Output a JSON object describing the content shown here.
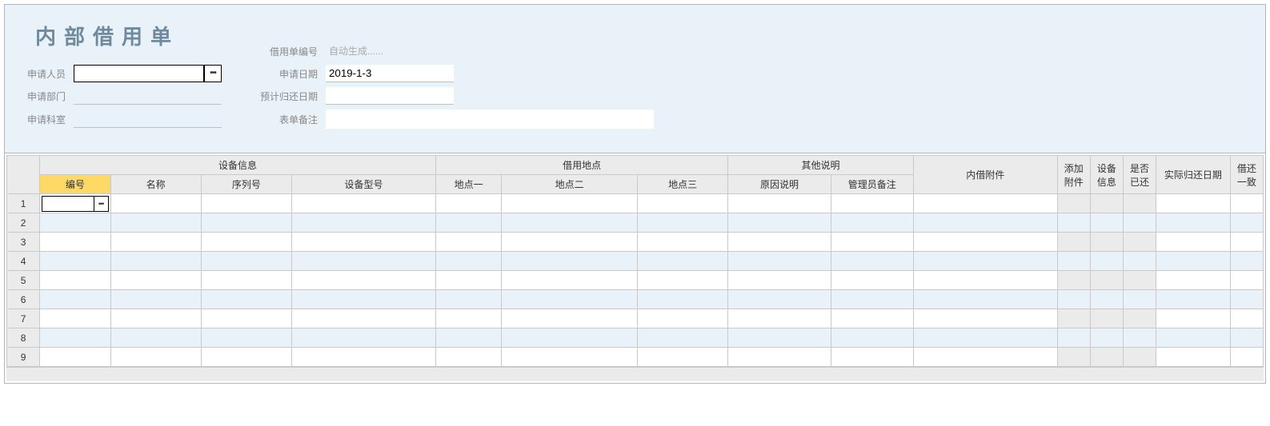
{
  "header": {
    "title": "内部借用单",
    "fields": {
      "applicant_label": "申请人员",
      "applicant_value": "",
      "dept_label": "申请部门",
      "dept_value": "",
      "office_label": "申请科室",
      "office_value": "",
      "order_no_label": "借用单编号",
      "order_no_placeholder": "自动生成......",
      "apply_date_label": "申请日期",
      "apply_date_value": "2019-1-3",
      "return_date_label": "预计归还日期",
      "return_date_value": "",
      "remark_label": "表单备注",
      "remark_value": ""
    },
    "picker_glyph": "•••"
  },
  "grid": {
    "group_headers": {
      "device_info": "设备信息",
      "location": "借用地点",
      "other": "其他说明",
      "attachment": "内借附件",
      "add_attach": "添加附件",
      "device_detail": "设备信息",
      "returned": "是否已还",
      "actual_return": "实际归还日期",
      "consistent": "借还一致"
    },
    "columns": {
      "no": "编号",
      "name": "名称",
      "serial": "序列号",
      "model": "设备型号",
      "loc1": "地点一",
      "loc2": "地点二",
      "loc3": "地点三",
      "reason": "原因说明",
      "admin_note": "管理员备注"
    },
    "rows": [
      {
        "idx": "1",
        "active": true
      },
      {
        "idx": "2",
        "active": false
      },
      {
        "idx": "3",
        "active": false
      },
      {
        "idx": "4",
        "active": false
      },
      {
        "idx": "5",
        "active": false
      },
      {
        "idx": "6",
        "active": false
      },
      {
        "idx": "7",
        "active": false
      },
      {
        "idx": "8",
        "active": false
      },
      {
        "idx": "9",
        "active": false
      }
    ]
  }
}
